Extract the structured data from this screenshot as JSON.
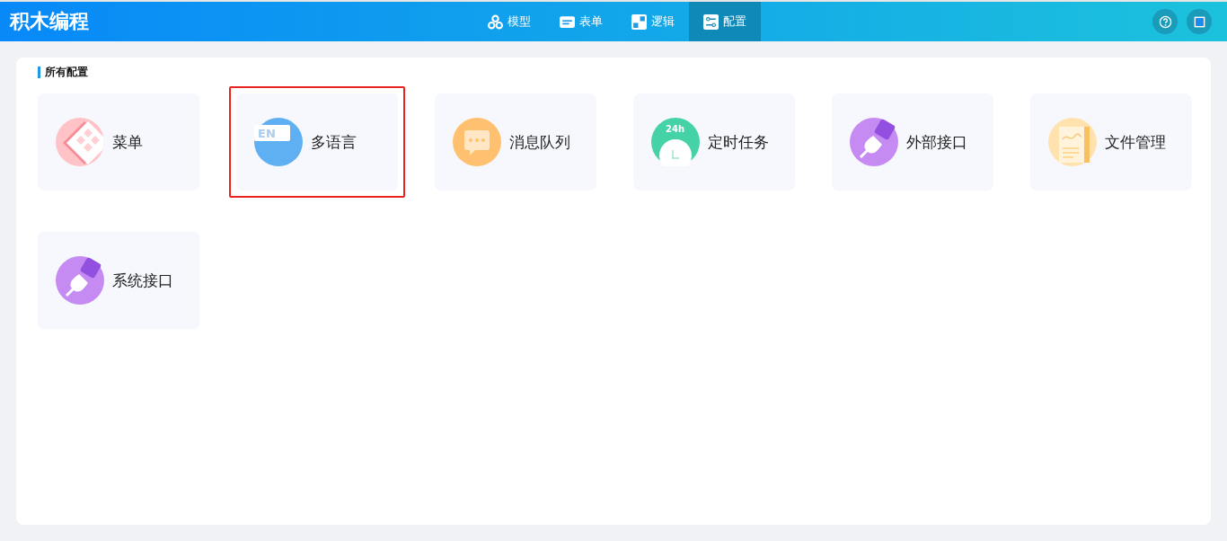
{
  "app": {
    "title": "积木编程"
  },
  "tabs": [
    {
      "label": "模型",
      "kind": "model",
      "selected": false
    },
    {
      "label": "表单",
      "kind": "form",
      "selected": false
    },
    {
      "label": "逻辑",
      "kind": "logic",
      "selected": false
    },
    {
      "label": "配置",
      "kind": "config",
      "selected": true
    }
  ],
  "section": {
    "title": "所有配置"
  },
  "cards": [
    {
      "label": "菜单",
      "kind": "menu",
      "highlighted": false
    },
    {
      "label": "多语言",
      "kind": "language",
      "icon_text": "EN",
      "highlighted": true
    },
    {
      "label": "消息队列",
      "kind": "message",
      "highlighted": false
    },
    {
      "label": "定时任务",
      "kind": "timer",
      "icon_text": "24h",
      "highlighted": false
    },
    {
      "label": "外部接口",
      "kind": "api",
      "highlighted": false
    },
    {
      "label": "文件管理",
      "kind": "file",
      "highlighted": false
    },
    {
      "label": "系统接口",
      "kind": "api",
      "highlighted": false
    }
  ]
}
